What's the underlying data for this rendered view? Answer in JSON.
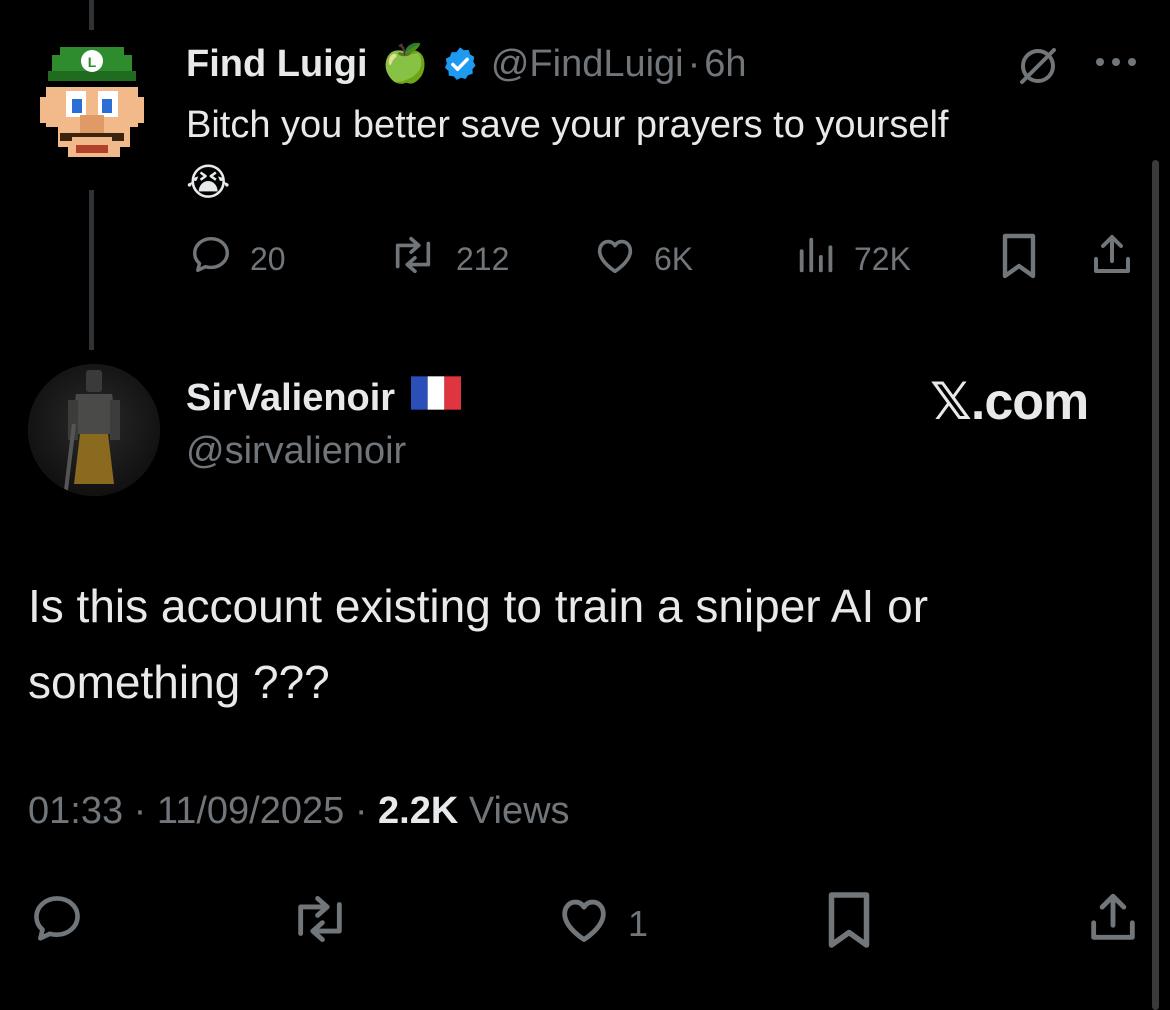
{
  "parent_tweet": {
    "author_name": "Find Luigi",
    "author_emoji": "🍏",
    "verified": true,
    "handle": "@FindLuigi",
    "separator": "·",
    "time": "6h",
    "text": "Bitch you better save your prayers to yourself 😭",
    "stats": {
      "replies": "20",
      "reposts": "212",
      "likes": "6K",
      "views": "72K"
    },
    "icons": [
      "grok-icon",
      "more-icon",
      "reply-icon",
      "repost-icon",
      "like-icon",
      "views-icon",
      "bookmark-icon",
      "share-icon"
    ]
  },
  "reply": {
    "author_name": "SirValienoir",
    "flag": "🇫🇷",
    "handle": "@sirvalienoir",
    "watermark": "𝕏.com",
    "text": "Is this account existing to train a sniper AI or something ???",
    "time": "01:33",
    "date": "11/09/2025",
    "views_count": "2.2K",
    "views_label": "Views",
    "separator": "·",
    "stats": {
      "likes": "1"
    }
  },
  "colors": {
    "background": "#000000",
    "text": "#e7e9ea",
    "muted": "#71767b",
    "verified_blue": "#1d9bf0",
    "thread_line": "#2f3336"
  }
}
